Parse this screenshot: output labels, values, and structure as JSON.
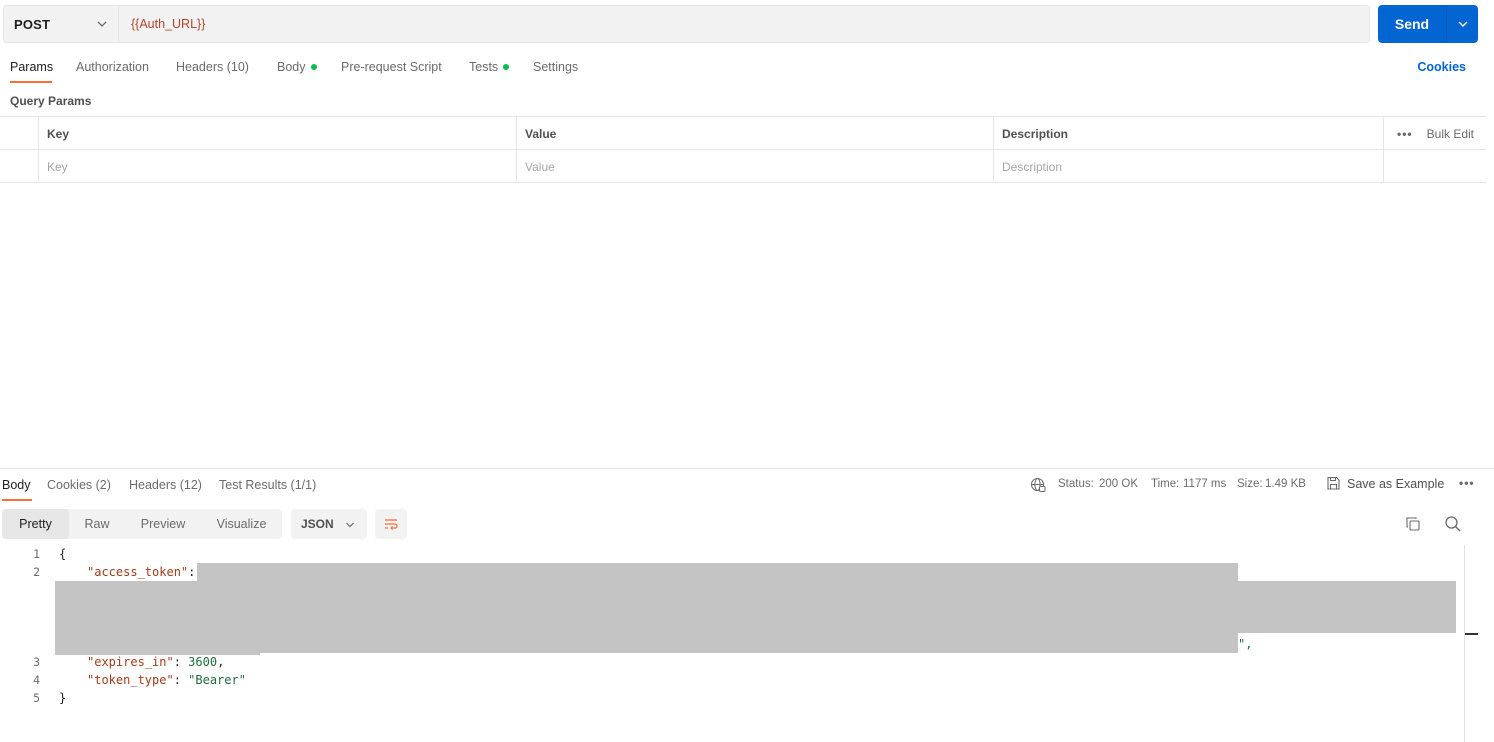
{
  "request": {
    "method": "POST",
    "url": "{{Auth_URL}}",
    "send_label": "Send"
  },
  "request_tabs": [
    {
      "label": "Params",
      "active": true,
      "dot": false
    },
    {
      "label": "Authorization",
      "active": false,
      "dot": false
    },
    {
      "label": "Headers (10)",
      "active": false,
      "dot": false
    },
    {
      "label": "Body",
      "active": false,
      "dot": true
    },
    {
      "label": "Pre-request Script",
      "active": false,
      "dot": false
    },
    {
      "label": "Tests",
      "active": false,
      "dot": true
    },
    {
      "label": "Settings",
      "active": false,
      "dot": false
    }
  ],
  "cookies_link": "Cookies",
  "query_params": {
    "title": "Query Params",
    "headers": {
      "key": "Key",
      "value": "Value",
      "description": "Description",
      "bulk_edit": "Bulk Edit"
    },
    "placeholders": {
      "key": "Key",
      "value": "Value",
      "description": "Description"
    }
  },
  "response_tabs": [
    {
      "label": "Body",
      "active": true
    },
    {
      "label": "Cookies (2)",
      "active": false
    },
    {
      "label": "Headers (12)",
      "active": false
    },
    {
      "label": "Test Results (1/1)",
      "active": false
    }
  ],
  "response_meta": {
    "status_label": "Status:",
    "status_value": "200 OK",
    "time_label": "Time:",
    "time_value": "1177 ms",
    "size_label": "Size:",
    "size_value": "1.49 KB",
    "save_example": "Save as Example"
  },
  "view_modes": [
    "Pretty",
    "Raw",
    "Preview",
    "Visualize"
  ],
  "active_view": "Pretty",
  "format": "JSON",
  "code": {
    "line_numbers": [
      "1",
      "2",
      "3",
      "4",
      "5"
    ],
    "open_brace": "{",
    "access_token_key": "\"access_token\"",
    "access_token_tail": "\",",
    "expires_in_key": "\"expires_in\"",
    "expires_in_value": "3600",
    "token_type_key": "\"token_type\"",
    "token_type_value": "\"Bearer\"",
    "close_brace": "}"
  },
  "colors": {
    "accent": "#ff6c37",
    "send": "#0265d2",
    "ok": "#0b8a3e",
    "dot": "#0cbb52"
  }
}
